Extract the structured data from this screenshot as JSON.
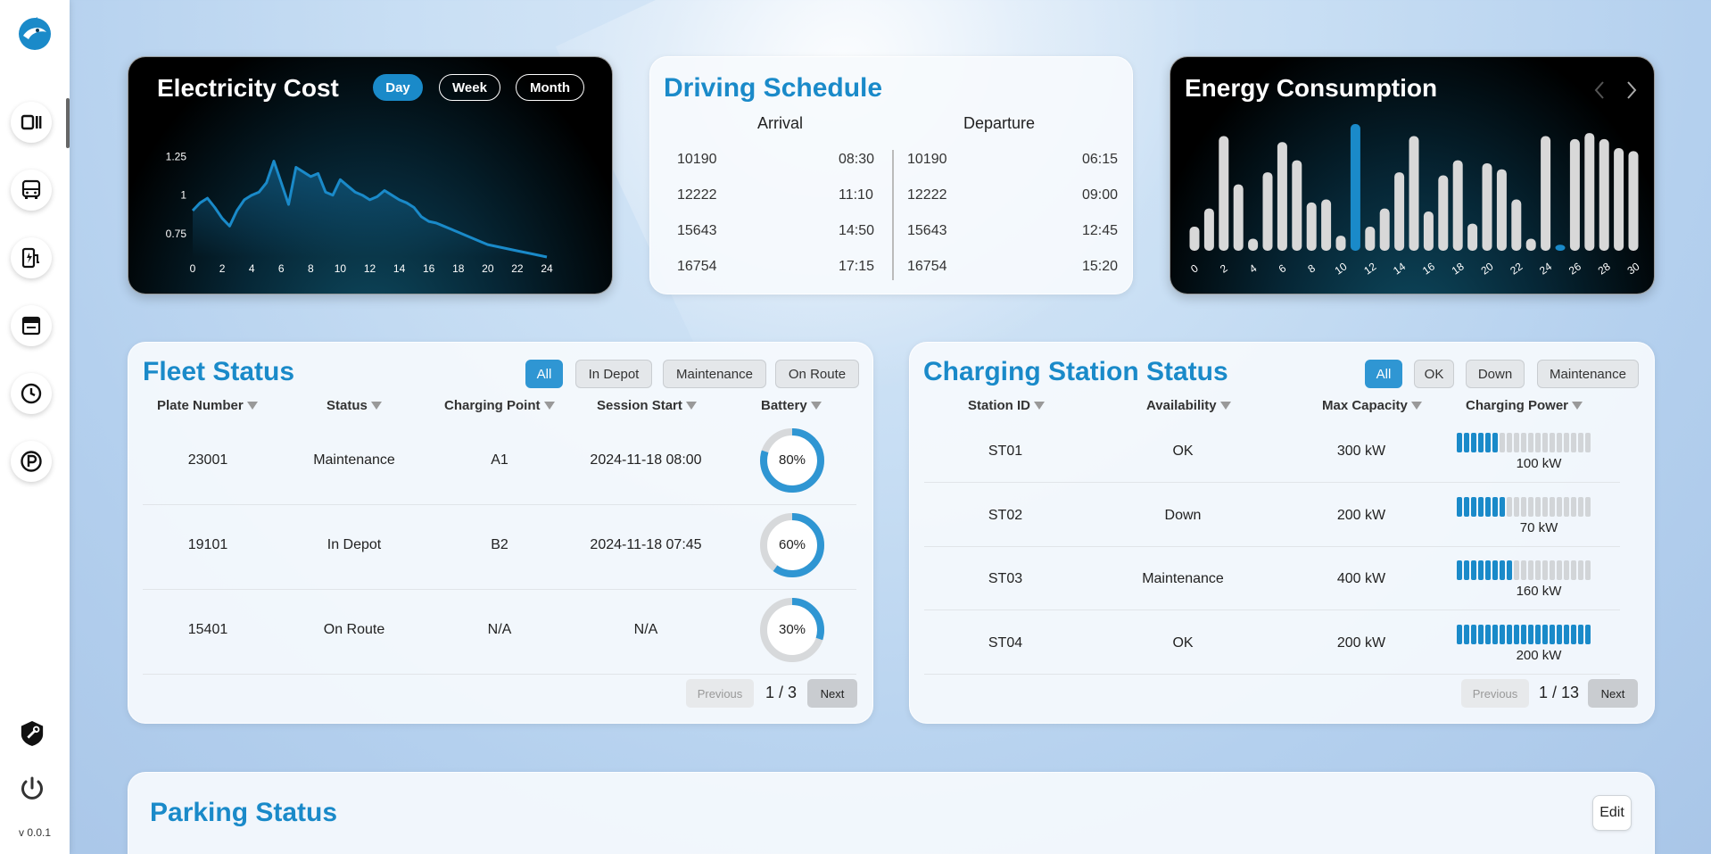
{
  "app": {
    "version": "v 0.0.1"
  },
  "sidebar": {
    "items": [
      {
        "icon": "dashboard-icon"
      },
      {
        "icon": "bus-icon"
      },
      {
        "icon": "charging-station-icon"
      },
      {
        "icon": "schedule-icon"
      },
      {
        "icon": "clock-icon"
      },
      {
        "icon": "parking-icon"
      }
    ],
    "bottom": [
      {
        "icon": "settings-shield-icon"
      },
      {
        "icon": "power-icon"
      }
    ]
  },
  "electricity_cost": {
    "title": "Electricity Cost",
    "periods": [
      "Day",
      "Week",
      "Month"
    ],
    "active_period": "Day"
  },
  "driving_schedule": {
    "title": "Driving Schedule",
    "arrival_label": "Arrival",
    "departure_label": "Departure",
    "arrivals": [
      {
        "id": "10190",
        "time": "08:30"
      },
      {
        "id": "12222",
        "time": "11:10"
      },
      {
        "id": "15643",
        "time": "14:50"
      },
      {
        "id": "16754",
        "time": "17:15"
      }
    ],
    "departures": [
      {
        "id": "10190",
        "time": "06:15"
      },
      {
        "id": "12222",
        "time": "09:00"
      },
      {
        "id": "15643",
        "time": "12:45"
      },
      {
        "id": "16754",
        "time": "15:20"
      }
    ]
  },
  "energy_consumption": {
    "title": "Energy Consumption"
  },
  "chart_data": [
    {
      "type": "line",
      "x": [
        0,
        0.5,
        1,
        1.5,
        2,
        2.5,
        3,
        3.5,
        4,
        4.5,
        5,
        5.5,
        6,
        6.5,
        7,
        7.5,
        8,
        8.5,
        9,
        9.5,
        10,
        10.5,
        11,
        11.5,
        12,
        12.5,
        13,
        13.5,
        14,
        14.5,
        15,
        15.5,
        16,
        16.5,
        17,
        17.5,
        18,
        18.5,
        19,
        19.5,
        20,
        21,
        22,
        23,
        24
      ],
      "values": [
        0.9,
        0.95,
        0.98,
        0.92,
        0.85,
        0.8,
        0.9,
        0.97,
        1.0,
        1.02,
        1.08,
        1.22,
        1.08,
        0.94,
        1.18,
        1.15,
        1.12,
        1.14,
        1.02,
        1.0,
        1.1,
        1.06,
        1.02,
        1.0,
        0.97,
        0.99,
        1.03,
        1.0,
        0.97,
        0.95,
        0.92,
        0.86,
        0.83,
        0.82,
        0.8,
        0.78,
        0.76,
        0.74,
        0.72,
        0.7,
        0.68,
        0.66,
        0.64,
        0.62,
        0.6
      ],
      "xticks": [
        0,
        2,
        4,
        6,
        8,
        10,
        12,
        14,
        16,
        18,
        20,
        22,
        24
      ],
      "yticks": [
        0.75,
        1,
        1.25
      ],
      "xlim": [
        0,
        24
      ],
      "ylim": [
        0.6,
        1.35
      ],
      "color": "#1a8ac9"
    },
    {
      "type": "bar",
      "categories": [
        0,
        1,
        2,
        3,
        4,
        5,
        6,
        7,
        8,
        9,
        10,
        11,
        12,
        13,
        14,
        15,
        16,
        17,
        18,
        19,
        20,
        21,
        22,
        23,
        24,
        25,
        26,
        27,
        28,
        29,
        30
      ],
      "values": [
        8,
        14,
        38,
        22,
        4,
        26,
        36,
        30,
        16,
        17,
        5,
        42,
        8,
        14,
        26,
        38,
        13,
        25,
        30,
        9,
        29,
        27,
        17,
        4,
        38,
        2,
        37,
        39,
        37,
        34,
        33
      ],
      "highlight": {
        "11": "#1a8ac9",
        "25": "#1a8ac9"
      },
      "xticks": [
        0,
        2,
        4,
        6,
        8,
        10,
        12,
        14,
        16,
        18,
        20,
        22,
        24,
        26,
        28,
        30
      ],
      "ylim": [
        0,
        42
      ],
      "color": "#d8d8d8"
    }
  ],
  "fleet_status": {
    "title": "Fleet Status",
    "filters": [
      "All",
      "In Depot",
      "Maintenance",
      "On Route"
    ],
    "active_filter": "All",
    "columns": [
      "Plate Number",
      "Status",
      "Charging Point",
      "Session Start",
      "Battery"
    ],
    "rows": [
      {
        "plate": "23001",
        "status": "Maintenance",
        "point": "A1",
        "start": "2024-11-18 08:00",
        "battery": "80%",
        "battery_level": 0.8
      },
      {
        "plate": "19101",
        "status": "In Depot",
        "point": "B2",
        "start": "2024-11-18 07:45",
        "battery": "60%",
        "battery_level": 0.6
      },
      {
        "plate": "15401",
        "status": "On Route",
        "point": "N/A",
        "start": "N/A",
        "battery": "30%",
        "battery_level": 0.3
      }
    ],
    "pager": {
      "prev": "Previous",
      "label": "1 / 3",
      "next": "Next"
    }
  },
  "charging_status": {
    "title": "Charging Station Status",
    "filters": [
      "All",
      "OK",
      "Down",
      "Maintenance"
    ],
    "active_filter": "All",
    "columns": [
      "Station ID",
      "Availability",
      "Max Capacity",
      "Charging Power"
    ],
    "rows": [
      {
        "id": "ST01",
        "availability": "OK",
        "capacity": "300 kW",
        "power": "100 kW",
        "power_level": 0.33
      },
      {
        "id": "ST02",
        "availability": "Down",
        "capacity": "200 kW",
        "power": "70 kW",
        "power_level": 0.35
      },
      {
        "id": "ST03",
        "availability": "Maintenance",
        "capacity": "400 kW",
        "power": "160 kW",
        "power_level": 0.4
      },
      {
        "id": "ST04",
        "availability": "OK",
        "capacity": "200 kW",
        "power": "200 kW",
        "power_level": 1.0
      }
    ],
    "pager": {
      "prev": "Previous",
      "label": "1 / 13",
      "next": "Next"
    }
  },
  "parking_status": {
    "title": "Parking Status",
    "edit_label": "Edit"
  }
}
